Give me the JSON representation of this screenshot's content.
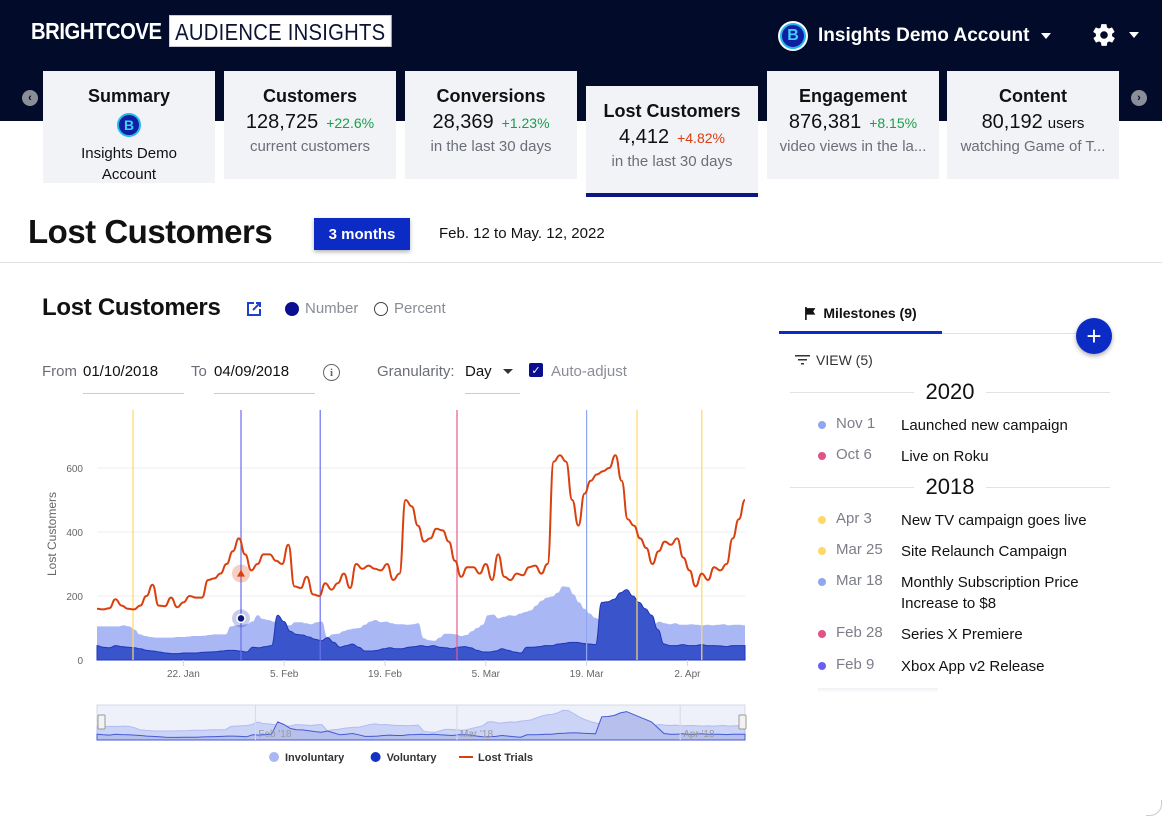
{
  "header": {
    "brand": "BRIGHTCOVE",
    "product": "AUDIENCE INSIGHTS",
    "account_name": "Insights Demo Account",
    "account_logo_letter": "B",
    "settings_icon": "gear-icon"
  },
  "cards": [
    {
      "title": "Summary",
      "logo_letter": "B",
      "name": "Insights Demo Account"
    },
    {
      "title": "Customers",
      "value": "128,725",
      "change": "+22.6%",
      "sub": "current customers"
    },
    {
      "title": "Conversions",
      "value": "28,369",
      "change": "+1.23%",
      "sub": "in the last 30 days"
    },
    {
      "title": "Lost Customers",
      "value": "4,412",
      "change": "+4.82%",
      "sub": "in the last 30 days"
    },
    {
      "title": "Engagement",
      "value": "876,381",
      "change": "+8.15%",
      "sub": "video views in the la..."
    },
    {
      "title": "Content",
      "value": "80,192",
      "unit": "users",
      "sub": "watching Game of T..."
    }
  ],
  "page": {
    "title": "Lost Customers",
    "range_button": "3 months",
    "range_text": "Feb. 12 to May. 12, 2022"
  },
  "chart_panel": {
    "title": "Lost Customers",
    "mode_number": "Number",
    "mode_percent": "Percent",
    "from_label": "From",
    "from_value": "01/10/2018",
    "to_label": "To",
    "to_value": "04/09/2018",
    "granularity_label": "Granularity:",
    "granularity_value": "Day",
    "auto_adjust_label": "Auto-adjust",
    "auto_adjust_checked": true
  },
  "chart_data": {
    "type": "area",
    "ylabel": "Lost Customers",
    "ylim": [
      0,
      800
    ],
    "yticks": [
      0,
      200,
      400,
      600
    ],
    "grid": true,
    "xlim_days": [
      0,
      90
    ],
    "xticks": [
      {
        "day": 12,
        "label": "22. Jan"
      },
      {
        "day": 26,
        "label": "5. Feb"
      },
      {
        "day": 40,
        "label": "19. Feb"
      },
      {
        "day": 54,
        "label": "5. Mar"
      },
      {
        "day": 68,
        "label": "19. Mar"
      },
      {
        "day": 82,
        "label": "2. Apr"
      }
    ],
    "navigator_labels": [
      {
        "day": 22,
        "label": "Feb '18"
      },
      {
        "day": 50,
        "label": "Mar '18"
      },
      {
        "day": 81,
        "label": "Apr '18"
      }
    ],
    "legend_position": "bottom",
    "series": [
      {
        "name": "Involuntary",
        "type": "area",
        "color": "#a9b8f5",
        "values": [
          105,
          105,
          105,
          105,
          105,
          108,
          105,
          95,
          80,
          75,
          72,
          70,
          70,
          70,
          70,
          72,
          72,
          73,
          75,
          75,
          76,
          78,
          80,
          80,
          80,
          105,
          108,
          110,
          112,
          120,
          140,
          128,
          125,
          120,
          115,
          110,
          108,
          118,
          118,
          115,
          112,
          118,
          120,
          72,
          80,
          82,
          90,
          95,
          98,
          100,
          110,
          120,
          125,
          118,
          120,
          115,
          112,
          112,
          110,
          112,
          115,
          68,
          62,
          60,
          70,
          82,
          82,
          80,
          75,
          78,
          90,
          100,
          110,
          140,
          142,
          130,
          135,
          140,
          138,
          145,
          150,
          155,
          170,
          185,
          195,
          198,
          210,
          230,
          228,
          205,
          180,
          160,
          145,
          132,
          125,
          122,
          120,
          118,
          120,
          118,
          116,
          115,
          118,
          115,
          112,
          120,
          115,
          112,
          115,
          110,
          110,
          112,
          110,
          108,
          110,
          108,
          110,
          112,
          108,
          110,
          110,
          108
        ]
      },
      {
        "name": "Voluntary",
        "type": "area",
        "color": "#3a55cc",
        "values": [
          45,
          40,
          38,
          45,
          42,
          40,
          38,
          35,
          30,
          28,
          25,
          22,
          20,
          20,
          22,
          22,
          22,
          24,
          25,
          26,
          28,
          30,
          30,
          28,
          25,
          40,
          38,
          42,
          45,
          140,
          120,
          90,
          80,
          78,
          72,
          65,
          60,
          70,
          55,
          40,
          45,
          50,
          40,
          28,
          28,
          30,
          35,
          38,
          35,
          35,
          40,
          42,
          45,
          42,
          45,
          40,
          38,
          35,
          40,
          42,
          38,
          30,
          25,
          25,
          28,
          35,
          30,
          25,
          22,
          40,
          40,
          42,
          45,
          45,
          50,
          52,
          55,
          55,
          52,
          50,
          48,
          180,
          182,
          190,
          210,
          220,
          200,
          180,
          160,
          140,
          95,
          50,
          45,
          45,
          48,
          45,
          45,
          48,
          45,
          45,
          44,
          42,
          45,
          45,
          45
        ]
      },
      {
        "name": "Lost Trials",
        "type": "line",
        "color": "#d9400f",
        "values": [
          160,
          158,
          162,
          190,
          170,
          160,
          158,
          170,
          200,
          235,
          170,
          168,
          195,
          165,
          180,
          200,
          195,
          195,
          250,
          255,
          270,
          300,
          340,
          380,
          330,
          280,
          300,
          330,
          330,
          310,
          300,
          360,
          230,
          225,
          260,
          205,
          200,
          240,
          220,
          240,
          270,
          225,
          300,
          285,
          295,
          285,
          280,
          300,
          250,
          270,
          500,
          480,
          420,
          370,
          380,
          410,
          405,
          370,
          310,
          260,
          290,
          290,
          270,
          300,
          250,
          330,
          260,
          250,
          270,
          265,
          290,
          295,
          270,
          300,
          620,
          640,
          620,
          500,
          420,
          520,
          560,
          580,
          590,
          600,
          640,
          560,
          440,
          420,
          380,
          350,
          300,
          340,
          370,
          360,
          380,
          320,
          280,
          230,
          270,
          250,
          290,
          280,
          300,
          380,
          440,
          500
        ]
      }
    ],
    "milestone_lines": [
      {
        "day": 5,
        "color": "#ffd866"
      },
      {
        "day": 20,
        "color": "#6b6ff0"
      },
      {
        "day": 31,
        "color": "#6b6ff0"
      },
      {
        "day": 50,
        "color": "#e85a8a"
      },
      {
        "day": 68,
        "color": "#8fa6f0"
      },
      {
        "day": 75,
        "color": "#ffd866"
      },
      {
        "day": 84,
        "color": "#ffd866"
      }
    ],
    "highlight": {
      "day": 20,
      "voluntary": 140,
      "lost_trials": 300
    }
  },
  "legend": [
    {
      "name": "Involuntary",
      "color": "#a9b8f5",
      "shape": "circle"
    },
    {
      "name": "Voluntary",
      "color": "#1431c4",
      "shape": "circle"
    },
    {
      "name": "Lost Trials",
      "color": "#d9400f",
      "shape": "line"
    }
  ],
  "milestones": {
    "tab_label": "Milestones (9)",
    "view_label": "VIEW (5)",
    "groups": [
      {
        "year": "2020",
        "items": [
          {
            "date": "Nov 1",
            "text": "Launched new campaign",
            "color": "#8fa6f0"
          },
          {
            "date": "Oct 6",
            "text": "Live on Roku",
            "color": "#e05288"
          }
        ]
      },
      {
        "year": "2018",
        "items": [
          {
            "date": "Apr 3",
            "text": "New TV campaign goes live",
            "color": "#ffd866"
          },
          {
            "date": "Mar 25",
            "text": "Site Relaunch Campaign",
            "color": "#ffd866"
          },
          {
            "date": "Mar 18",
            "text": "Monthly Subscription Price Increase to $8",
            "color": "#8fa6f0"
          },
          {
            "date": "Feb 28",
            "text": "Series X Premiere",
            "color": "#e05288"
          },
          {
            "date": "Feb 9",
            "text": "Xbox App v2 Release",
            "color": "#6b5ff0"
          }
        ]
      }
    ]
  }
}
